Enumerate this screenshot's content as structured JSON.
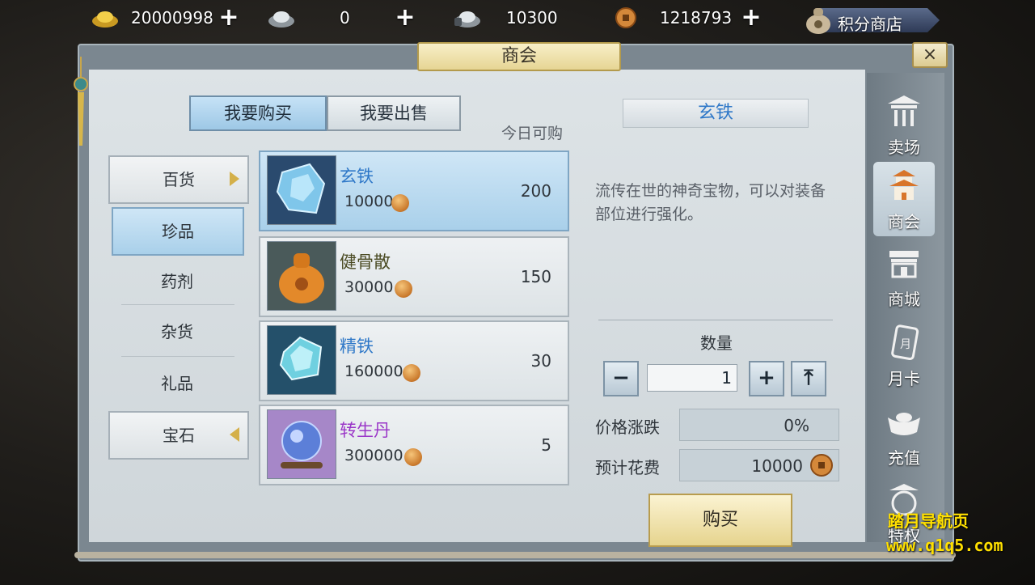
{
  "top_bar": {
    "gold_ingot": "20000998",
    "silver_ingot": "0",
    "silver_bound": "10300",
    "copper_coin": "1218793",
    "points_shop_label": "积分商店"
  },
  "window": {
    "title": "商会",
    "close_label": "×"
  },
  "tabs": {
    "buy": "我要购买",
    "sell": "我要出售"
  },
  "today_label": "今日可购",
  "categories": [
    {
      "label": "百货"
    },
    {
      "label": "珍品"
    },
    {
      "label": "药剂"
    },
    {
      "label": "杂货"
    },
    {
      "label": "礼品"
    },
    {
      "label": "宝石"
    }
  ],
  "items": [
    {
      "name": "玄铁",
      "price": "10000",
      "count": "200",
      "color": "#2f78c8",
      "icon": "blue-ore-icon"
    },
    {
      "name": "健骨散",
      "price": "30000",
      "count": "150",
      "color": "#4a4a22",
      "icon": "orange-pouch-icon"
    },
    {
      "name": "精铁",
      "price": "160000",
      "count": "30",
      "color": "#2f78c8",
      "icon": "crystal-icon"
    },
    {
      "name": "转生丹",
      "price": "300000",
      "count": "5",
      "color": "#9b37c8",
      "icon": "pill-orb-icon"
    }
  ],
  "detail": {
    "name": "玄铁",
    "description": "流传在世的神奇宝物，可以对装备部位进行强化。",
    "quantity_label": "数量",
    "quantity": "1",
    "price_change_label": "价格涨跌",
    "price_change": "0%",
    "est_cost_label": "预计花费",
    "est_cost": "10000",
    "buy_label": "购买",
    "minus": "−",
    "plus": "+",
    "max": "⤒"
  },
  "sidebar": [
    {
      "label": "卖场"
    },
    {
      "label": "商会"
    },
    {
      "label": "商城"
    },
    {
      "label": "月卡"
    },
    {
      "label": "充值"
    },
    {
      "label": "特权"
    }
  ],
  "watermark": {
    "line1": "踏月导航页",
    "line2": "www.q1q5.com"
  }
}
